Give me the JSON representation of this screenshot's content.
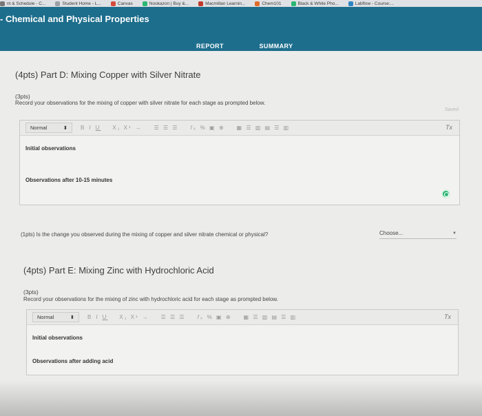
{
  "browser": {
    "bookmarks": [
      {
        "label": "nt & Schedule - C...",
        "icon": "bookmark-icon",
        "color": "#777777"
      },
      {
        "label": "Student Home - L...",
        "icon": "bookmark-icon",
        "color": "#9aa0a6"
      },
      {
        "label": "Canvas",
        "icon": "canvas-icon",
        "color": "#d44a3c"
      },
      {
        "label": "Nookazon | Buy &...",
        "icon": "nookazon-icon",
        "color": "#2bb673"
      },
      {
        "label": "Macmillan Learnin...",
        "icon": "macmillan-icon",
        "color": "#c0392b"
      },
      {
        "label": "Chem101",
        "icon": "chem101-icon",
        "color": "#e06c2c"
      },
      {
        "label": "Black & White Pho...",
        "icon": "photo-icon",
        "color": "#2bb673"
      },
      {
        "label": "Labflow - Course:...",
        "icon": "labflow-icon",
        "color": "#2e86c1"
      }
    ]
  },
  "header": {
    "title": "- Chemical and Physical Properties",
    "tabs": [
      {
        "label": "REPORT",
        "active": true
      },
      {
        "label": "SUMMARY",
        "active": false
      }
    ],
    "color": "#1d6e8c"
  },
  "partD": {
    "title": "(4pts) Part D: Mixing Copper with Silver Nitrate",
    "points": "(3pts)",
    "instruction": "Record your observations for the mixing of copper with silver nitrate for each stage as prompted below.",
    "saved": "Saved",
    "editor": {
      "format": "Normal",
      "lines": [
        "Initial observations",
        "Observations after 10-15 minutes"
      ]
    },
    "question": {
      "text": "(1pts)  Is the change you observed during the mixing of copper and silver nitrate chemical or physical?",
      "select_value": "Choose..."
    }
  },
  "partE": {
    "title": "(4pts) Part E: Mixing Zinc with Hydrochloric Acid",
    "points": "(3pts)",
    "instruction": "Record your observations for the mixing of zinc with hydrochloric acid for each stage as prompted below.",
    "editor": {
      "format": "Normal",
      "lines": [
        "Initial observations",
        "Observations after adding acid"
      ]
    }
  },
  "toolbar": {
    "bold": "B",
    "italic": "I",
    "underline": "U",
    "subsup": "X₁ X¹",
    "arrow": "→",
    "lists": "☰ ☰ ☰",
    "formula": "𝑓ₓ",
    "clear": "Tx"
  }
}
